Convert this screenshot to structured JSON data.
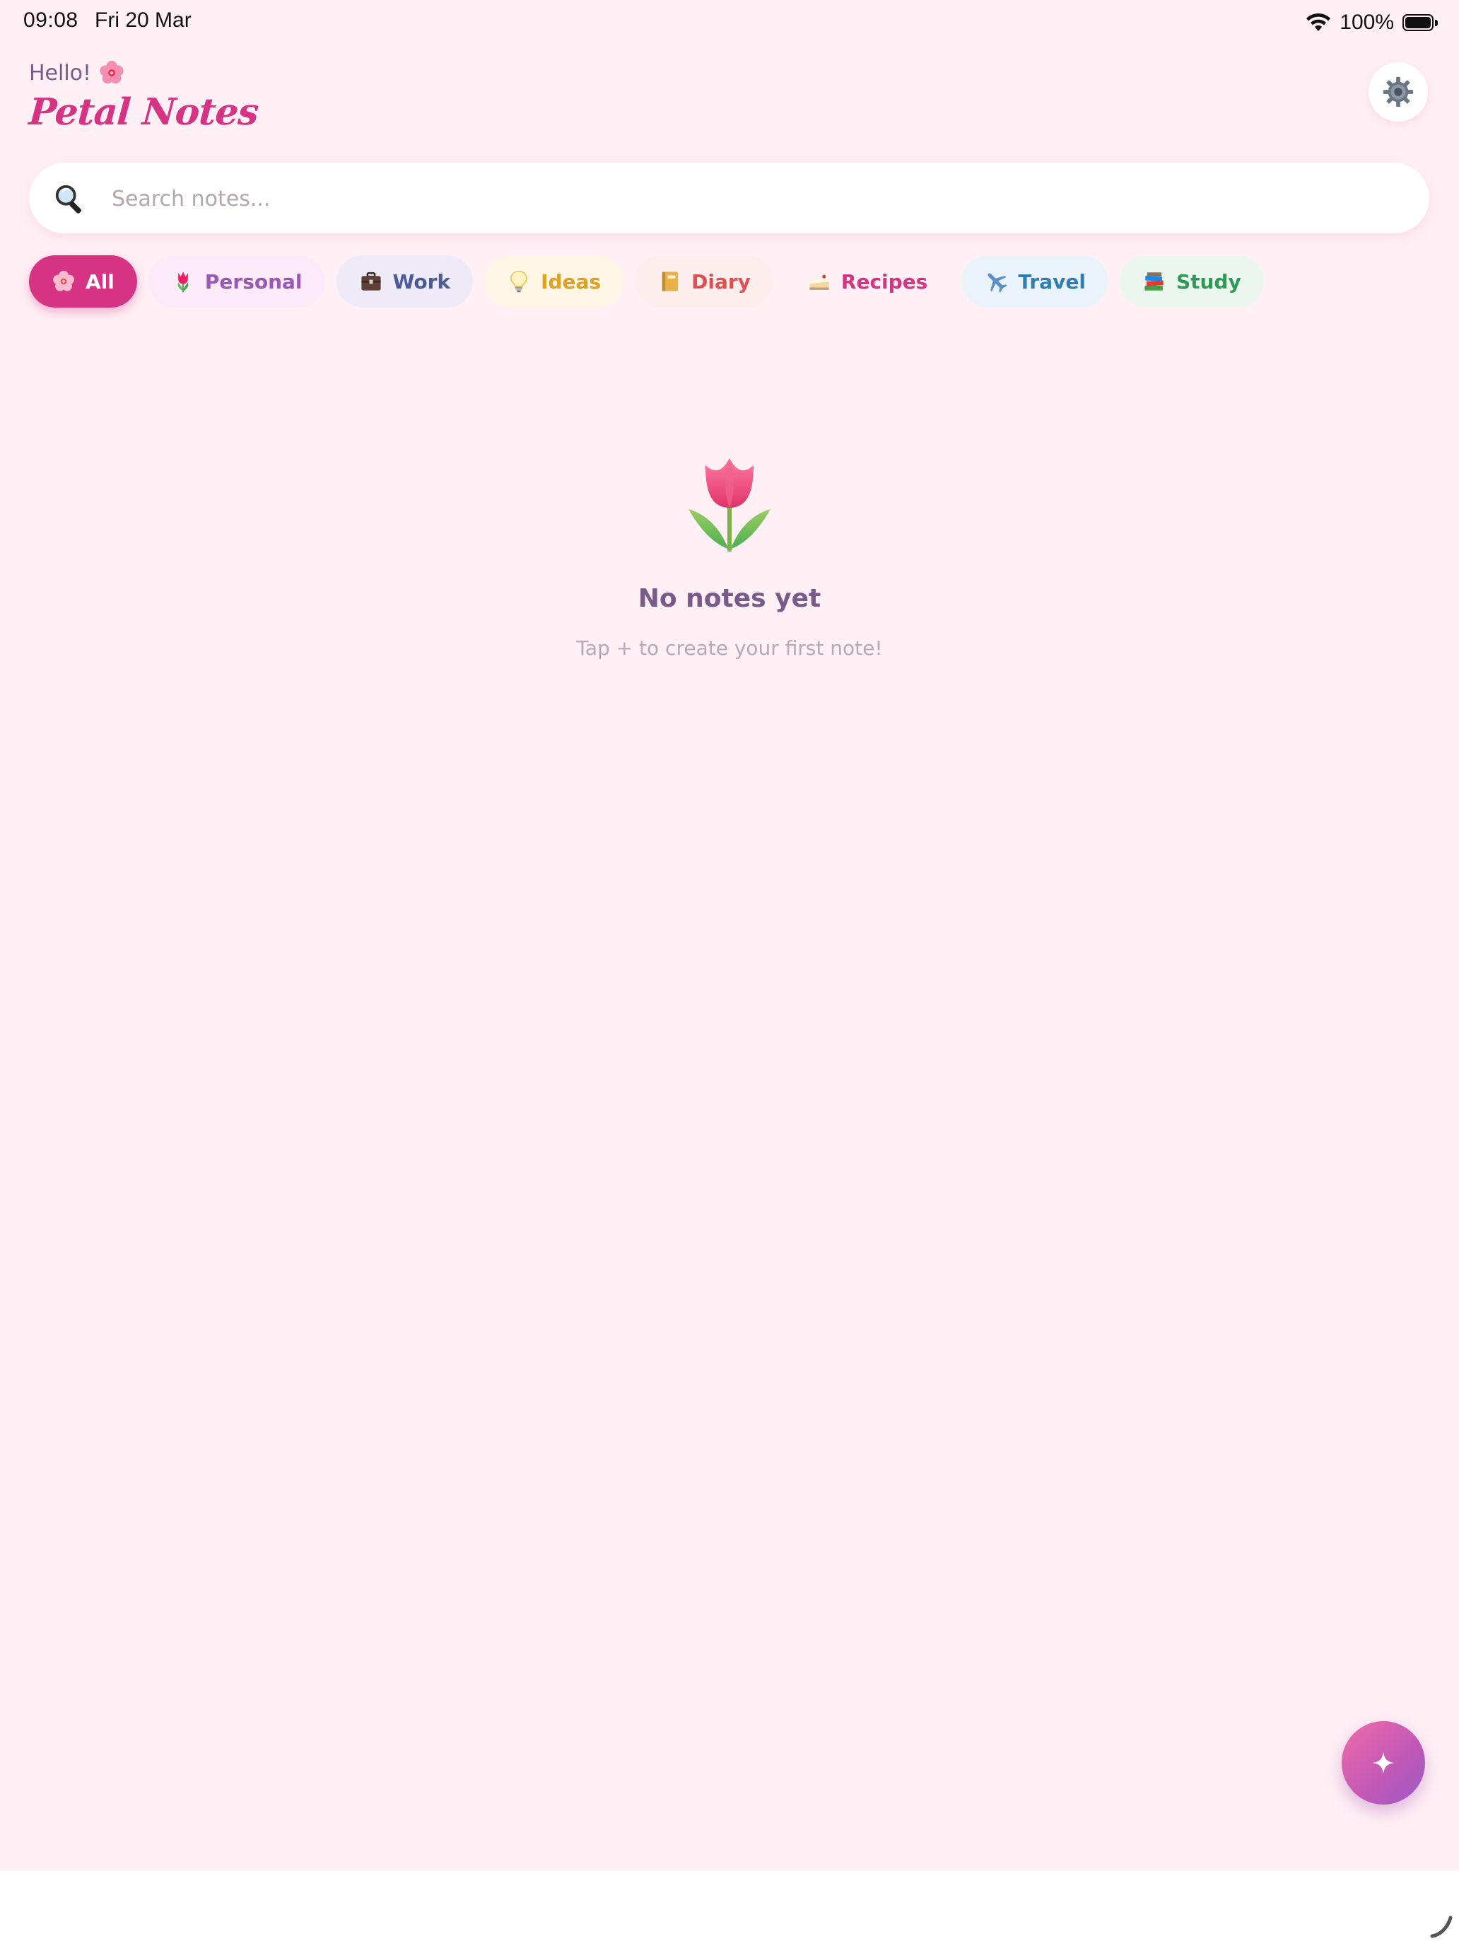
{
  "status_bar": {
    "time": "09:08",
    "date": "Fri 20 Mar",
    "battery": "100%",
    "icons": [
      "wifi-icon",
      "battery-icon"
    ]
  },
  "header": {
    "greeting": "Hello!",
    "greeting_icon": "cherry-blossom-icon",
    "app_title": "Petal Notes",
    "settings_icon": "gear-icon"
  },
  "search": {
    "placeholder": "Search notes...",
    "value": "",
    "icon": "search-icon"
  },
  "categories": [
    {
      "label": "All",
      "icon": "cherry-blossom-icon",
      "active": true,
      "text_color": "#ffffff",
      "bg": "#d63384"
    },
    {
      "label": "Personal",
      "icon": "tulip-icon",
      "active": false,
      "text_color": "#9b59b6",
      "bg": "#fbeaf8"
    },
    {
      "label": "Work",
      "icon": "briefcase-icon",
      "active": false,
      "text_color": "#4a5a9a",
      "bg": "#efeaf8"
    },
    {
      "label": "Ideas",
      "icon": "lightbulb-icon",
      "active": false,
      "text_color": "#e0a020",
      "bg": "#fff6e6"
    },
    {
      "label": "Diary",
      "icon": "notebook-icon",
      "active": false,
      "text_color": "#e05050",
      "bg": "#fdeeee"
    },
    {
      "label": "Recipes",
      "icon": "cake-icon",
      "active": false,
      "text_color": "#d63384",
      "bg": "#fff0f5"
    },
    {
      "label": "Travel",
      "icon": "airplane-icon",
      "active": false,
      "text_color": "#2f7fb5",
      "bg": "#ebf3fa"
    },
    {
      "label": "Study",
      "icon": "books-icon",
      "active": false,
      "text_color": "#2e9a55",
      "bg": "#eaf6ee"
    }
  ],
  "empty_state": {
    "icon": "tulip-icon",
    "title": "No notes yet",
    "subtitle": "Tap + to create your first note!"
  },
  "fab": {
    "icon": "sparkle-icon"
  },
  "colors": {
    "background": "#fff0f5",
    "accent": "#d63384",
    "title": "#d63384",
    "muted_text": "#7a5a8a",
    "placeholder": "#b3a6b1"
  }
}
